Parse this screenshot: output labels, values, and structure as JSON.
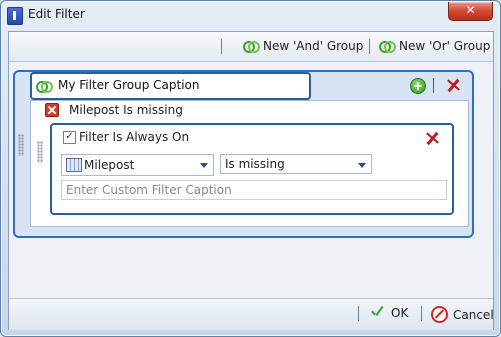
{
  "window": {
    "title": "Edit Filter",
    "close_label": "✕"
  },
  "toolbar": {
    "new_and_group": "New 'And' Group",
    "new_or_group": "New 'Or' Group"
  },
  "group": {
    "caption": "My Filter Group Caption"
  },
  "condition": {
    "label": "Milepost Is missing"
  },
  "filter": {
    "always_on_label": "Filter Is Always On",
    "always_on_checked": true,
    "field": "Milepost",
    "operator": "Is missing",
    "custom_caption_placeholder": "Enter Custom Filter Caption"
  },
  "footer": {
    "ok_label": "OK",
    "cancel_label": "Cancel"
  },
  "colors": {
    "accent_border": "#2f6fbf",
    "delete_red": "#c01d1d",
    "add_green": "#2e9b20"
  }
}
